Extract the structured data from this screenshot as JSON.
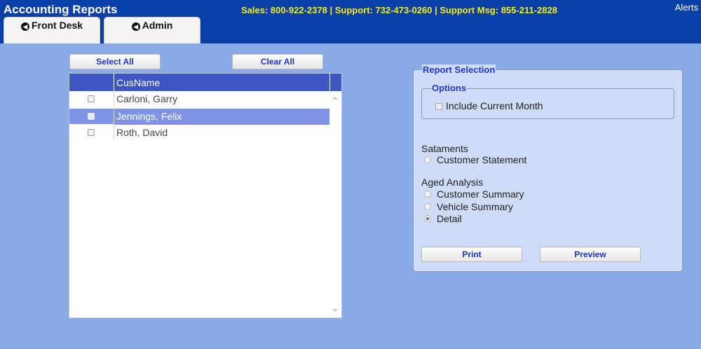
{
  "header": {
    "title": "Accounting Reports",
    "contact": "Sales: 800-922-2378 | Support: 732-473-0260 | Support Msg: 855-211-2828",
    "alerts": "Alerts",
    "tabs": [
      {
        "label": "Front Desk",
        "icon": "circle-arrow-left-icon"
      },
      {
        "label": "Admin",
        "icon": "circle-arrow-left-icon"
      }
    ]
  },
  "toolbar": {
    "select_all": "Select All",
    "clear_all": "Clear All"
  },
  "grid": {
    "columns": [
      "CusName"
    ],
    "rows": [
      {
        "name": "Carloni, Garry",
        "selected": false
      },
      {
        "name": "Jennings, Felix",
        "selected": true
      },
      {
        "name": "Roth, David",
        "selected": false
      }
    ]
  },
  "report": {
    "legend": "Report Selection",
    "options_legend": "Options",
    "include_current_month": "Include Current Month",
    "statements_title": "Sataments",
    "customer_statement": "Customer Statement",
    "aged_title": "Aged Analysis",
    "customer_summary": "Customer Summary",
    "vehicle_summary": "Vehicle Summary",
    "detail": "Detail",
    "selected_report": "Detail",
    "print": "Print",
    "preview": "Preview"
  },
  "colors": {
    "header_bg": "#0b3fa8",
    "page_bg": "#8aaae6",
    "contact_text": "#f2ee1f",
    "grid_header": "#3e55c4",
    "selected_row": "#7f93e6",
    "panel_bg": "#cfdcf7",
    "accent_text": "#2235d0"
  }
}
